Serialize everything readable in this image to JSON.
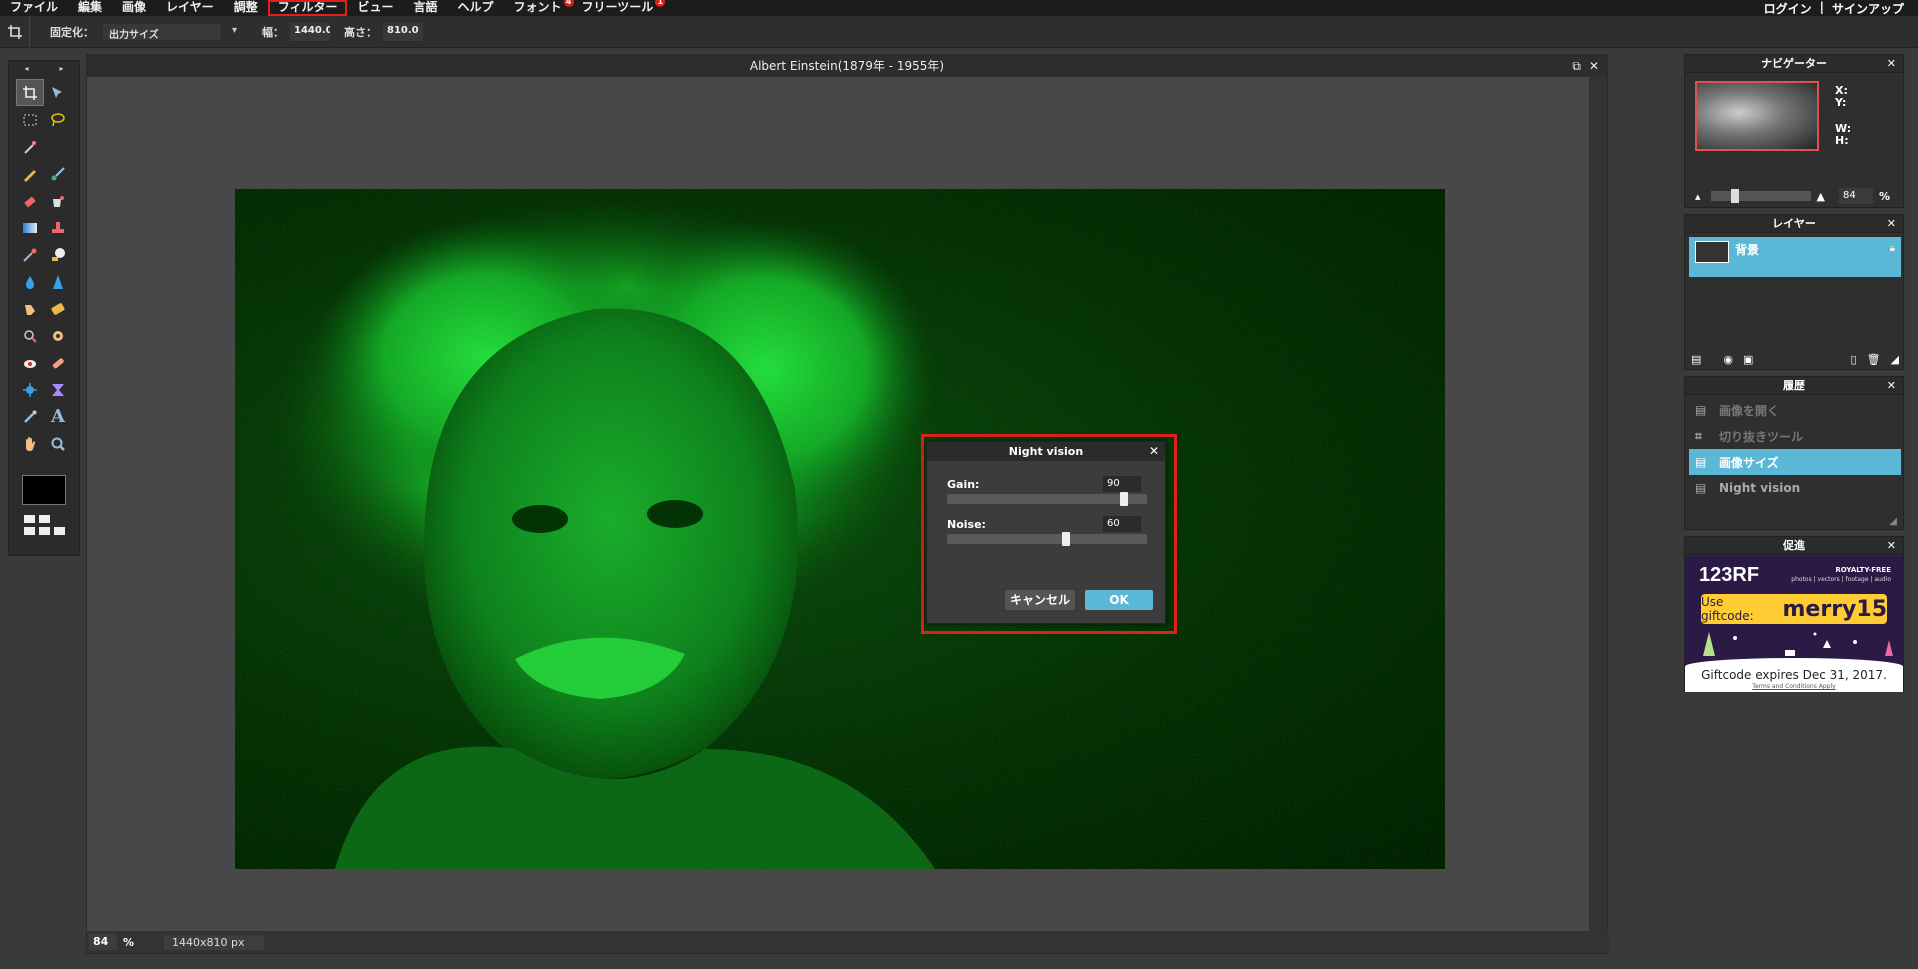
{
  "menubar": {
    "items": [
      "ファイル",
      "編集",
      "画像",
      "レイヤー",
      "調整",
      "フィルター",
      "ビュー",
      "言語",
      "ヘルプ",
      "フォント",
      "フリーツール"
    ],
    "font_badge": "4",
    "freetool_badge": "1",
    "login": "ログイン",
    "separator": "|",
    "signup": "サインアップ"
  },
  "optbar": {
    "fixed_label": "固定化：",
    "fixed_value": "出力サイズ",
    "width_label": "幅：",
    "width_value": "1440.0",
    "height_label": "高さ：",
    "height_value": "810.0"
  },
  "document": {
    "title": "Albert Einstein(1879年 - 1955年)",
    "zoom": "84",
    "zoom_unit": "%",
    "size": "1440x810 px"
  },
  "dialog": {
    "title": "Night vision",
    "gain_label": "Gain:",
    "gain_value": "90",
    "gain_fraction": 0.9,
    "noise_label": "Noise:",
    "noise_value": "60",
    "noise_fraction": 0.6,
    "cancel_label": "キャンセル",
    "ok_label": "OK"
  },
  "navigator": {
    "title": "ナビゲーター",
    "x_label": "X:",
    "y_label": "Y:",
    "w_label": "W:",
    "h_label": "H:",
    "zoom_value": "84",
    "zoom_unit": "%"
  },
  "layers": {
    "title": "レイヤー",
    "items": [
      "背景"
    ]
  },
  "history": {
    "title": "履歴",
    "items": [
      "画像を開く",
      "切り抜きツール",
      "画像サイズ",
      "Night vision"
    ]
  },
  "promo": {
    "title": "促進",
    "logo": "123RF",
    "royalty": "ROYALTY-FREE",
    "categories": "photos | vectors | footage | audio",
    "use_label": "Use giftcode:",
    "code": "merry15",
    "expires": "Giftcode expires Dec 31, 2017.",
    "terms": "Terms and Conditions Apply"
  },
  "colors": {
    "accent": "#5ab8d6",
    "highlight": "#e0201a"
  }
}
